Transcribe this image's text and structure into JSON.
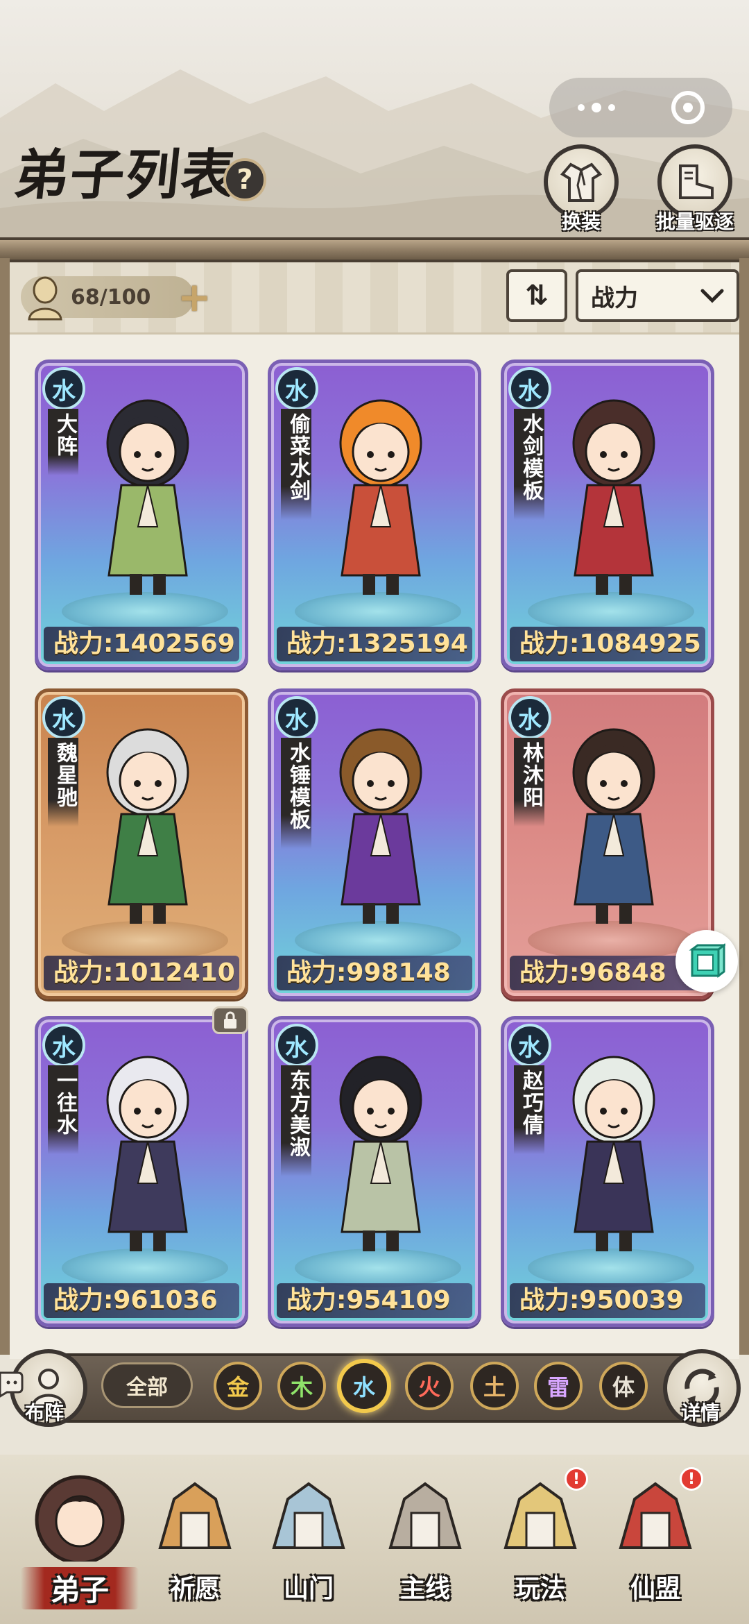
{
  "page": {
    "title": "弟子列表",
    "help_glyph": "?"
  },
  "top_buttons": {
    "outfit_label": "换装",
    "dismiss_label": "批量驱逐"
  },
  "roster": {
    "count": "68/100",
    "sort_toggle_glyph": "⇅",
    "sort_by": "战力",
    "sort_chevron": "⌄"
  },
  "disciples": [
    {
      "element": "水",
      "name": "大阵",
      "power": "战力:1402569",
      "frame": "purple"
    },
    {
      "element": "水",
      "name": "偷菜水剑",
      "power": "战力:1325194",
      "frame": "purple"
    },
    {
      "element": "水",
      "name": "水剑模板",
      "power": "战力:1084925",
      "frame": "purple"
    },
    {
      "element": "水",
      "name": "魏星驰",
      "power": "战力:1012410",
      "frame": "orange"
    },
    {
      "element": "水",
      "name": "水锤模板",
      "power": "战力:998148",
      "frame": "purple"
    },
    {
      "element": "水",
      "name": "林沐阳",
      "power": "战力:96848",
      "frame": "red"
    },
    {
      "element": "水",
      "name": "一往水",
      "power": "战力:961036",
      "frame": "purple",
      "locked": true
    },
    {
      "element": "水",
      "name": "东方美淑",
      "power": "战力:954109",
      "frame": "purple"
    },
    {
      "element": "水",
      "name": "赵巧倩",
      "power": "战力:950039",
      "frame": "purple"
    }
  ],
  "filter": {
    "formation_label": "布阵",
    "details_label": "详情",
    "all_label": "全部",
    "elements": [
      {
        "label": "金",
        "color": "#f2c94c"
      },
      {
        "label": "木",
        "color": "#8fe36a"
      },
      {
        "label": "水",
        "color": "#8fe0ff",
        "active": true
      },
      {
        "label": "火",
        "color": "#ff6a5a"
      },
      {
        "label": "土",
        "color": "#e8b56a"
      },
      {
        "label": "雷",
        "color": "#d8a6ff"
      },
      {
        "label": "体",
        "color": "#e8e2d6"
      }
    ]
  },
  "nav": {
    "items": [
      {
        "label": "弟子",
        "active": true
      },
      {
        "label": "祈愿"
      },
      {
        "label": "山门"
      },
      {
        "label": "主线"
      },
      {
        "label": "玩法",
        "badge": "!"
      },
      {
        "label": "仙盟",
        "badge": "!"
      }
    ]
  }
}
